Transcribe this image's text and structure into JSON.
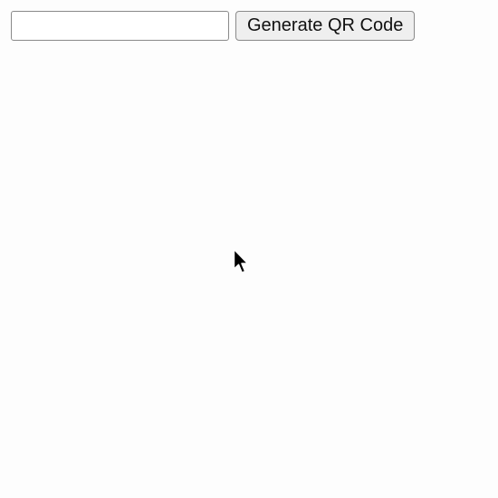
{
  "form": {
    "text_input": {
      "value": "",
      "placeholder": ""
    },
    "generate_button_label": "Generate QR Code"
  },
  "cursor": {
    "icon": "arrow-pointer-icon"
  }
}
